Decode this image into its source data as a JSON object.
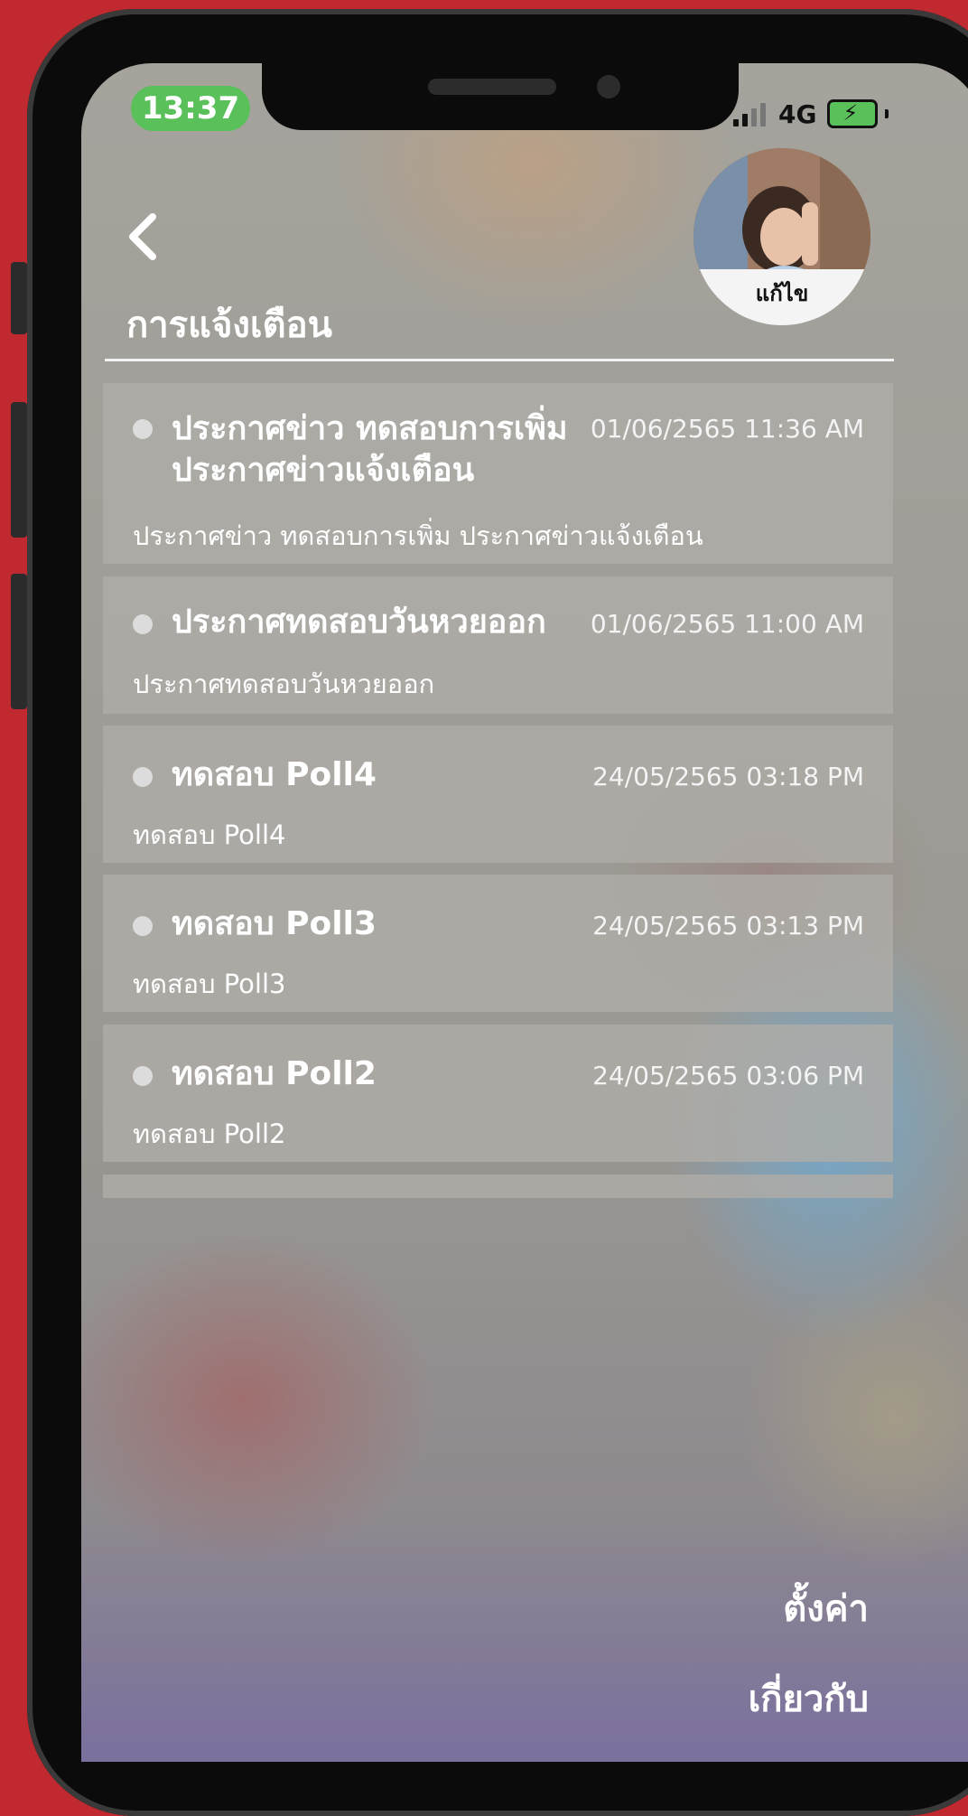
{
  "status_bar": {
    "time": "13:37",
    "network": "4G"
  },
  "header": {
    "title": "การแจ้งเตือน",
    "avatar_edit_label": "แก้ไข"
  },
  "notifications": [
    {
      "title": "ประกาศข่าว ทดสอบการเพิ่ม ประกาศข่าวแจ้งเตือน",
      "date": "01/06/2565 11:36 AM",
      "body": "ประกาศข่าว ทดสอบการเพิ่ม ประกาศข่าวแจ้งเตือน"
    },
    {
      "title": "ประกาศทดสอบวันหวยออก",
      "date": "01/06/2565 11:00 AM",
      "body": "ประกาศทดสอบวันหวยออก"
    },
    {
      "title": "ทดสอบ Poll4",
      "date": "24/05/2565 03:18 PM",
      "body": "ทดสอบ Poll4"
    },
    {
      "title": "ทดสอบ Poll3",
      "date": "24/05/2565 03:13 PM",
      "body": "ทดสอบ Poll3"
    },
    {
      "title": "ทดสอบ Poll2",
      "date": "24/05/2565 03:06 PM",
      "body": "ทดสอบ Poll2"
    }
  ],
  "menu": {
    "settings": "ตั้งค่า",
    "about": "เกี่ยวกับ"
  },
  "icons": {
    "back": "chevron-left-icon",
    "avatar": "user-photo"
  },
  "colors": {
    "background_red": "#c0292f",
    "time_pill_green": "#5ac05a"
  }
}
